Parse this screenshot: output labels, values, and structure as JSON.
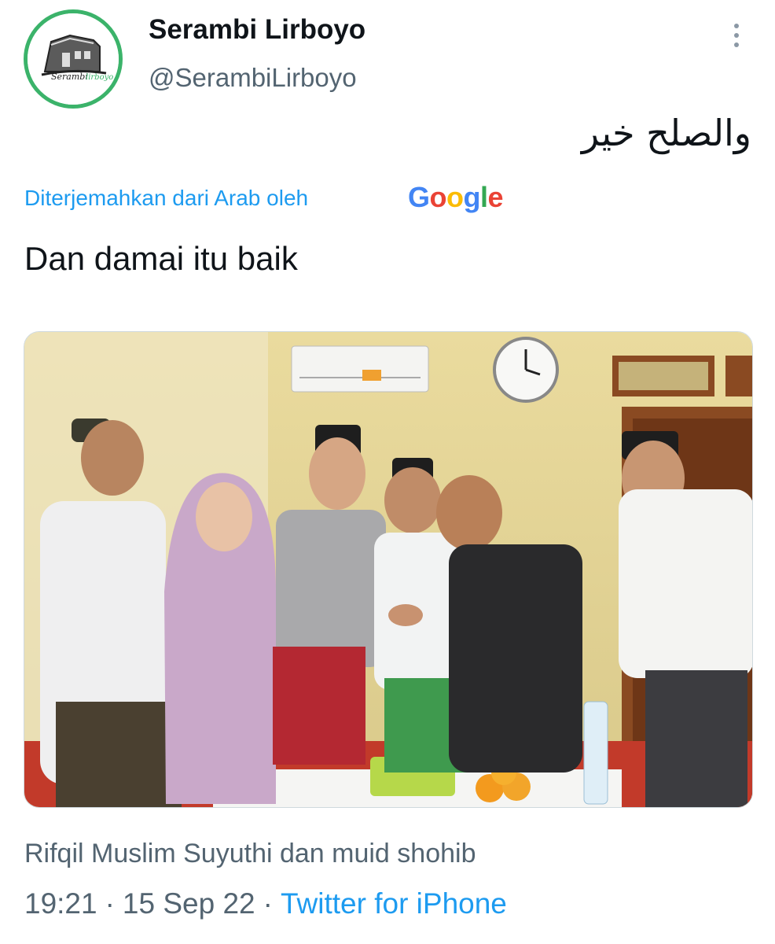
{
  "tweet": {
    "author": {
      "display_name": "Serambi Lirboyo",
      "handle": "@SerambiLirboyo",
      "avatar_icon": "serambi-lirboyo-logo",
      "avatar_ring_color": "#3bb36a"
    },
    "more_icon": "vertical-ellipsis-icon",
    "original_text": "والصلح خير",
    "translation_label": "Diterjemahkan dari Arab oleh",
    "translation_provider": "Google",
    "translated_text": "Dan damai itu baik",
    "media_caption": "Rifqil Muslim Suyuthi dan muid shohib",
    "time": "19:21",
    "date": "15 Sep 22",
    "separator": "·",
    "source": "Twitter for iPhone"
  },
  "colors": {
    "link": "#1d9bf0",
    "secondary_text": "#536471",
    "primary_text": "#0f1419"
  }
}
